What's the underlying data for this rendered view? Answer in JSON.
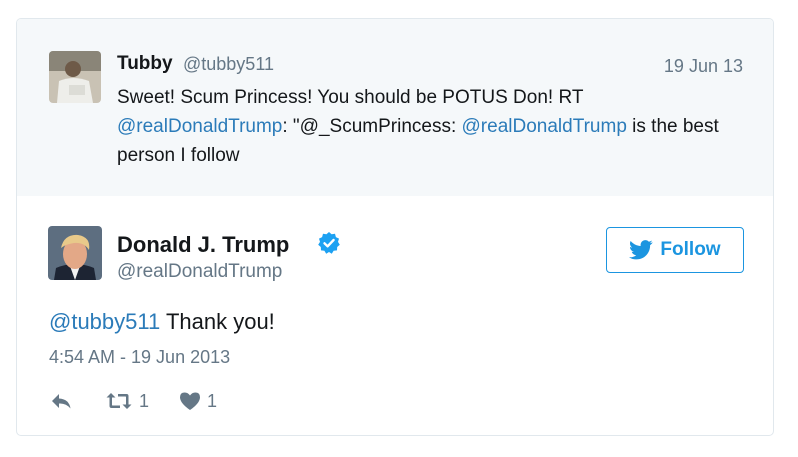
{
  "quoted_tweet": {
    "author_name": "Tubby",
    "author_handle": "@tubby511",
    "date": "19 Jun 13",
    "text_line1": "Sweet! Scum Princess! You should be POTUS Don! RT",
    "mention_1": "@realDonaldTrump",
    "text_mid": ": \"@_ScumPrincess: ",
    "mention_2": "@realDonaldTrump",
    "text_end": " is the best person I follow"
  },
  "main_tweet": {
    "author_name": "Donald J. Trump",
    "author_handle": "@realDonaldTrump",
    "follow_label": "Follow",
    "reply_mention": "@tubby511",
    "reply_text": " Thank you!",
    "timestamp": "4:54 AM - 19 Jun 2013",
    "retweet_count": "1",
    "like_count": "1"
  },
  "icons": {
    "verified": "verified-badge-icon",
    "follow": "twitter-bird-icon",
    "reply": "reply-icon",
    "retweet": "retweet-icon",
    "like": "heart-icon"
  },
  "colors": {
    "accent": "#1b95e0",
    "link": "#2b7bb9",
    "muted": "#657786",
    "text": "#14171a",
    "quoted_bg": "#f5f8fa",
    "border": "#e1e8ed"
  }
}
